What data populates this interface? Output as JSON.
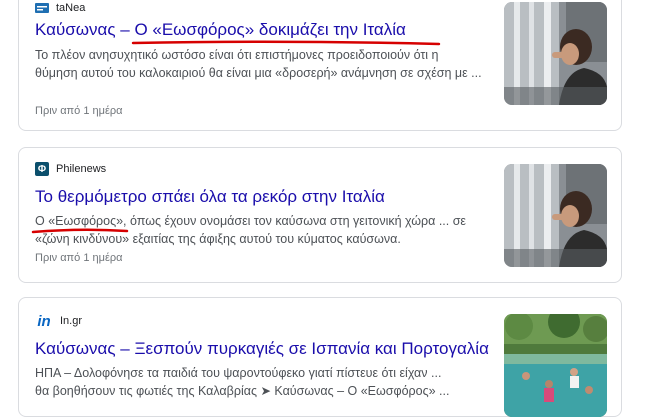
{
  "results": [
    {
      "source": "taNea",
      "title": "Καύσωνας – Ο «Εωσφόρος» δοκιμάζει την Ιταλία",
      "snippet_1": "Το πλέον ανησυχητικό ωστόσο είναι ότι επιστήμονες προειδοποιούν ότι η",
      "snippet_2": "θύμηση αυτού του καλοκαιριού θα είναι μια «δροσερή» ανάμνηση σε σχέση με ...",
      "time": "Πριν από 1 ημέρα",
      "favicon_icon": "tanea-favicon",
      "thumbnail": "woman-at-fountain-photo"
    },
    {
      "source": "Philenews",
      "title": "Το θερμόμετρο σπάει όλα τα ρεκόρ στην Ιταλία",
      "snippet_1": "Ο «Εωσφόρος», όπως έχουν ονομάσει τον καύσωνα στη γειτονική χώρα ... σε",
      "snippet_2": "«ζώνη κινδύνου» εξαιτίας της άφιξης αυτού του κύματος καύσωνα.",
      "time": "Πριν από 1 ημέρα",
      "favicon_icon": "phi-icon",
      "favicon_glyph": "Φ",
      "thumbnail": "woman-at-fountain-photo"
    },
    {
      "source": "In.gr",
      "title": "Καύσωνας – Ξεσπούν πυρκαγιές σε Ισπανία και Πορτογαλία",
      "snippet_1": "ΗΠΑ – Δολοφόνησε τα παιδιά του ψαροντούφεκο γιατί πίστευε ότι είχαν ...",
      "snippet_2": "θα βοηθήσουν τις φωτιές της Καλαβρίας ➤ Καύσωνας – Ο «Εωσφόρος» ...",
      "favicon_icon": "in-logo-icon",
      "favicon_glyph": "in",
      "thumbnail": "people-swimming-river-photo"
    }
  ],
  "colors": {
    "title": "#1a0dab",
    "underline": "#d60000",
    "text": "#4d5156",
    "muted": "#70757a"
  }
}
